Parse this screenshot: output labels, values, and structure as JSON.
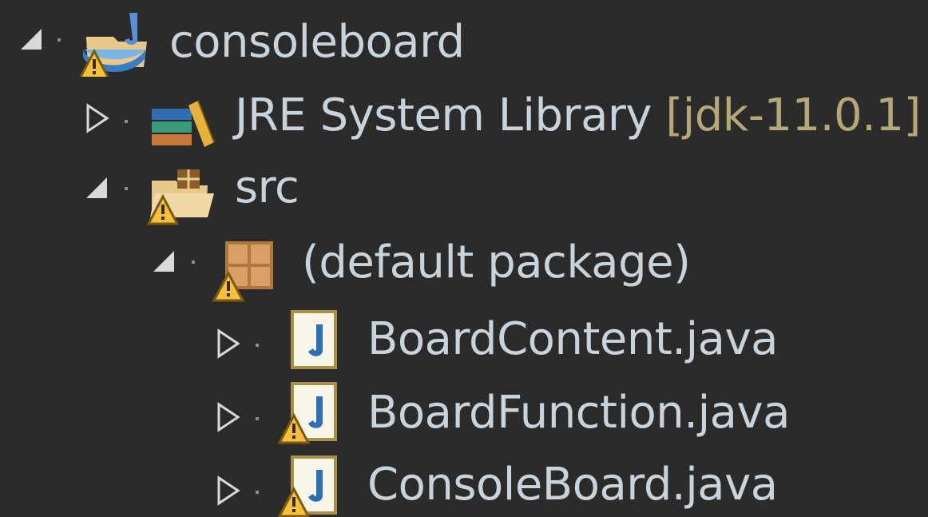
{
  "tree": {
    "items": [
      {
        "label": "consoleboard",
        "decoration": "",
        "icon": "java-project-icon",
        "expanded": true,
        "warning": true
      },
      {
        "label": "JRE System Library",
        "decoration": " [jdk-11.0.1]",
        "icon": "library-icon",
        "expanded": false,
        "warning": false
      },
      {
        "label": "src",
        "decoration": "",
        "icon": "source-folder-icon",
        "expanded": true,
        "warning": true
      },
      {
        "label": "(default package)",
        "decoration": "",
        "icon": "package-icon",
        "expanded": true,
        "warning": true
      },
      {
        "label": "BoardContent.java",
        "decoration": "",
        "icon": "java-file-icon",
        "expanded": false,
        "warning": false
      },
      {
        "label": "BoardFunction.java",
        "decoration": "",
        "icon": "java-file-icon",
        "expanded": false,
        "warning": true
      },
      {
        "label": "ConsoleBoard.java",
        "decoration": "",
        "icon": "java-file-icon",
        "expanded": false,
        "warning": true
      }
    ]
  },
  "colors": {
    "background": "#2b2b2b",
    "text": "#c8d3dc",
    "decoration": "#b6a779",
    "warning": "#f3c13a"
  }
}
